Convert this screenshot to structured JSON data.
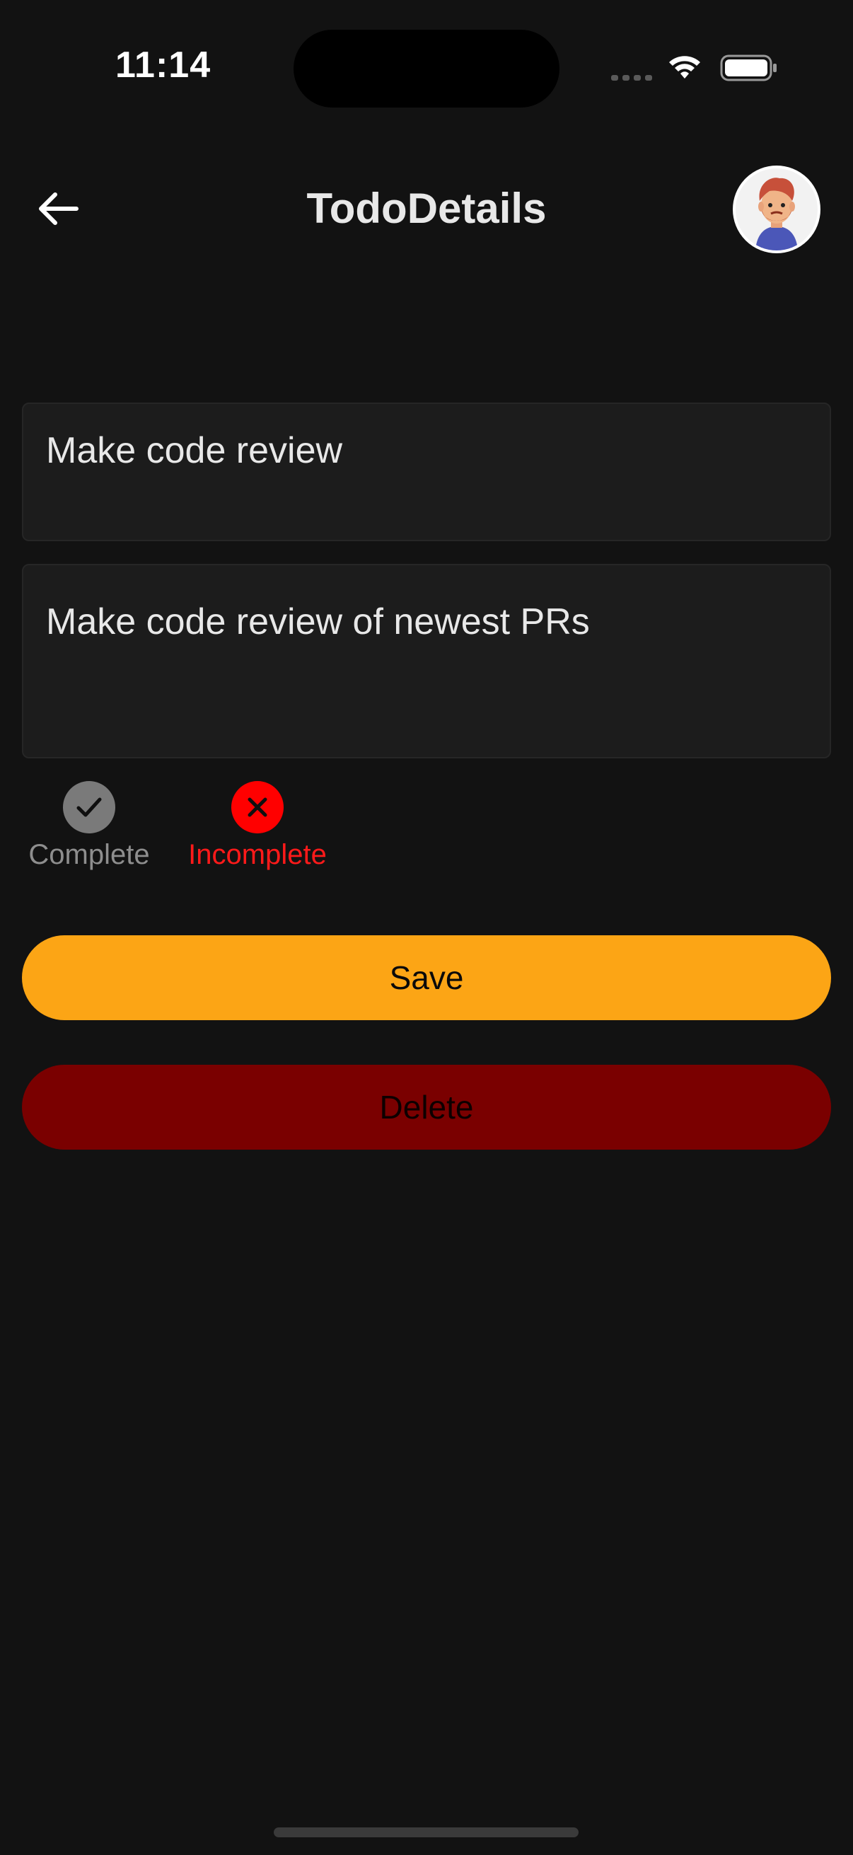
{
  "status_bar": {
    "time": "11:14"
  },
  "header": {
    "title": "TodoDetails",
    "back_icon": "arrow-left-icon",
    "avatar_icon": "user-avatar-icon"
  },
  "form": {
    "title_value": "Make code review",
    "description_value": "Make code review of newest PRs"
  },
  "status_toggle": {
    "complete_label": "Complete",
    "incomplete_label": "Incomplete",
    "selected": "Incomplete",
    "complete_icon": "checkmark-icon",
    "incomplete_icon": "x-icon"
  },
  "actions": {
    "save_label": "Save",
    "delete_label": "Delete"
  },
  "colors": {
    "background": "#121212",
    "save": "#fca515",
    "delete": "#7a0000",
    "incomplete": "#ff0000"
  }
}
